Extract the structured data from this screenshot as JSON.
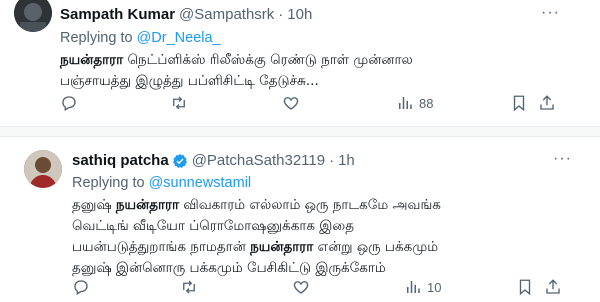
{
  "tweet1": {
    "author_name": "Sampath Kumar",
    "handle": "@Sampathsrk",
    "dot": "·",
    "time": "10h",
    "replying_label": "Replying to",
    "replying_to": "@Dr_Neela_",
    "body_bold": "நயன்தாரா",
    "body_rest": " நெட்ப்ளிக்ஸ் ரிலீஸ்க்கு ரெண்டு நாள் முன்னால\nபஞ்சாயத்து இழுத்து பப்ளிசிட்டி தேடுச்சு...",
    "views": "88",
    "more": "···"
  },
  "tweet2": {
    "author_name": "sathiq patcha",
    "handle": "@PatchaSath32119",
    "dot": "·",
    "time": "1h",
    "replying_label": "Replying to",
    "replying_to": "@sunnewstamil",
    "line1_a": "தனுஷ் ",
    "line1_bold": "நயன்தாரா",
    "line1_b": " விவகாரம் எல்லாம் ஒரு நாடகமே அவங்க",
    "line2": "வெட்டிங் வீடியோ ப்ரொமோஷனுக்காக இதை",
    "line3_a": "பயன்படுத்துறாங்க நாமதான் ",
    "line3_bold": "நயன்தாரா",
    "line3_b": " என்று ஒரு பக்கமும்",
    "line4": "தனுஷ் இன்னொரு பக்கமும் பேசிகிட்டு இருக்கோம்",
    "views": "10",
    "more": "···",
    "verified_color": "#1d9bf0"
  },
  "colors": {
    "accent": "#1d9bf0",
    "secondary_text": "#536471"
  }
}
